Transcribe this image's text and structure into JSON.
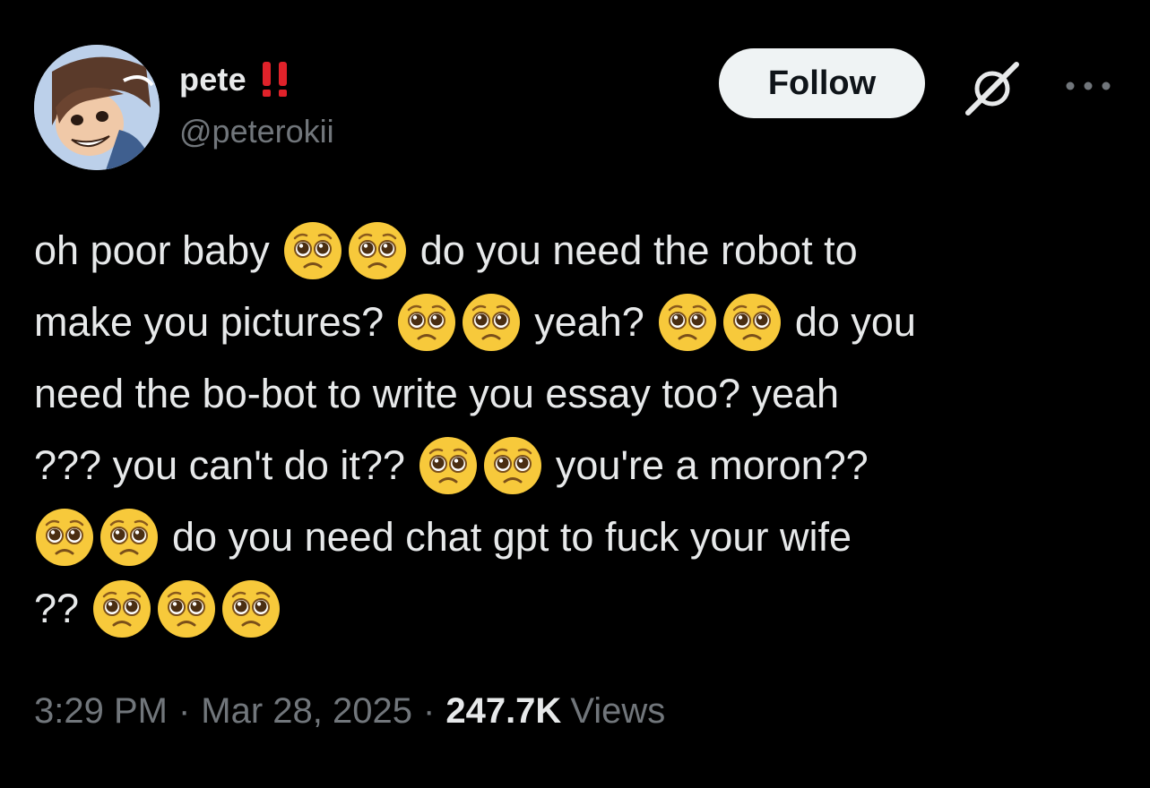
{
  "author": {
    "display_name": "pete",
    "handle": "@peterokii",
    "name_emoji": "red-double-exclamation-icon"
  },
  "header": {
    "follow_label": "Follow",
    "grok_icon": "grok-icon",
    "more_icon": "more-icon"
  },
  "tweet": {
    "emoji_name": "pleading-face-icon",
    "lines": [
      {
        "before": "oh poor baby",
        "emoji_count": 2,
        "after": "do you need the robot to"
      },
      {
        "before": "make you pictures?",
        "emoji_count": 2,
        "middle": "yeah?",
        "emoji_count_2": 2,
        "after": "do you"
      },
      {
        "before": "need the bo-bot to write you essay too? yeah"
      },
      {
        "before": "??? you can't do it??",
        "emoji_count": 2,
        "after": "you're a moron??"
      },
      {
        "emoji_count": 2,
        "after": "do you need chat gpt to fuck your wife"
      },
      {
        "before": "??",
        "emoji_count": 3
      }
    ]
  },
  "meta": {
    "time": "3:29 PM",
    "separator": "·",
    "date": "Mar 28, 2025",
    "views_count": "247.7K",
    "views_label": "Views"
  },
  "colors": {
    "background": "#000000",
    "text": "#e7e9ea",
    "secondary": "#71767b",
    "follow_bg": "#eff3f4",
    "emoji_yellow": "#f7c93b",
    "exclaim_red": "#e0222a"
  }
}
